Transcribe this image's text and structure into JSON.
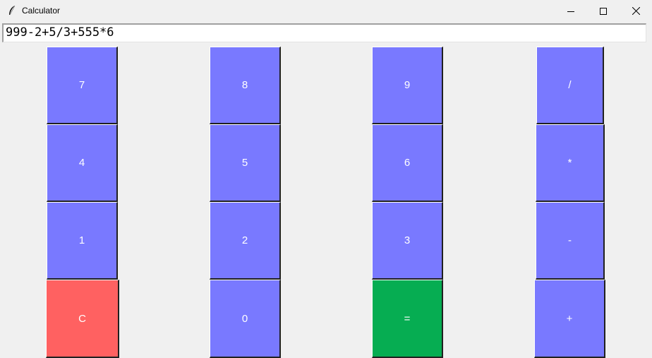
{
  "window": {
    "title": "Calculator",
    "controls": [
      "minimize",
      "maximize",
      "close"
    ]
  },
  "display": {
    "value": "999-2+5/3+555*6"
  },
  "colors": {
    "digit_operator": "#7979ff",
    "clear": "#ff6161",
    "equals": "#06ad52",
    "background": "#f0f0f0"
  },
  "keypad": {
    "row1": [
      "7",
      "8",
      "9",
      "/"
    ],
    "row2": [
      "4",
      "5",
      "6",
      "*"
    ],
    "row3": [
      "1",
      "2",
      "3",
      "-"
    ],
    "row4": [
      "C",
      "0",
      "=",
      "+"
    ]
  }
}
